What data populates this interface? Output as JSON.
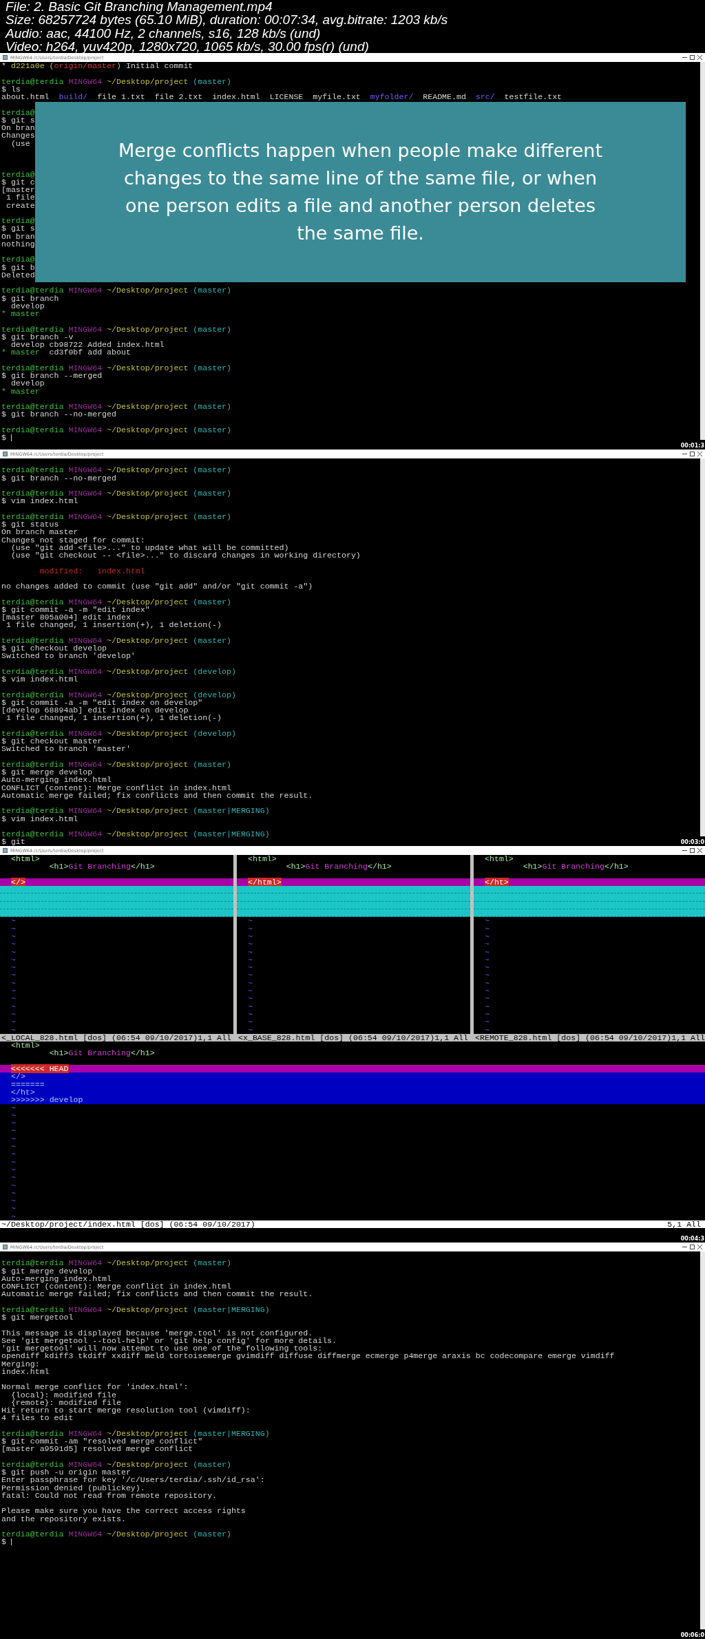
{
  "header": {
    "lines": [
      "File: 2. Basic Git Branching Management.mp4",
      "Size: 68257724 bytes (65.10 MiB), duration: 00:07:34, avg.bitrate: 1203 kb/s",
      "Audio: aac, 44100 Hz, 2 channels, s16, 128 kb/s (und)",
      "Video: h264, yuv420p, 1280x720, 1065 kb/s, 30.00 fps(r) (und)"
    ]
  },
  "frames": [
    {
      "kind": "terminal",
      "title": "MINGW64:/c/Users/terdia/Desktop/project",
      "timestamp": "00:01:3",
      "overlay": {
        "text": "Merge conflicts happen when people make different changes to the same line of the same file, or when one person edits a file and another person deletes the same file."
      },
      "lines": [
        {
          "kind": "segments",
          "segments": [
            {
              "kind": "plain",
              "text": "* "
            },
            {
              "kind": "hash",
              "text": "d221a0e ("
            },
            {
              "kind": "ref",
              "text": "origin/master"
            },
            {
              "kind": "hash",
              "text": ")"
            },
            {
              "kind": "plain",
              "text": " Initial commit"
            }
          ]
        },
        {
          "kind": "blank"
        },
        {
          "kind": "prompt",
          "user": "terdia@terdia",
          "system": "MINGW64",
          "path": "~/Desktop/project",
          "branch": "(master)"
        },
        {
          "kind": "text",
          "text": "$ ls"
        },
        {
          "kind": "segments",
          "segments": [
            {
              "kind": "plain",
              "text": "about.html  "
            },
            {
              "kind": "dir",
              "text": "build/"
            },
            {
              "kind": "plain",
              "text": "  file 1.txt  file 2.txt  index.html  LICENSE  myfile.txt  "
            },
            {
              "kind": "dir",
              "text": "myfolder/"
            },
            {
              "kind": "plain",
              "text": "  README.md  "
            },
            {
              "kind": "dir",
              "text": "src/"
            },
            {
              "kind": "plain",
              "text": "  testfile.txt"
            }
          ]
        },
        {
          "kind": "blank"
        },
        {
          "kind": "green",
          "text": "terdia@"
        },
        {
          "kind": "text",
          "text": "$ git s"
        },
        {
          "kind": "text",
          "text": "On bran"
        },
        {
          "kind": "text",
          "text": "Changes"
        },
        {
          "kind": "text",
          "text": "  (use"
        },
        {
          "kind": "blank"
        },
        {
          "kind": "blank"
        },
        {
          "kind": "blank"
        },
        {
          "kind": "green",
          "text": "terdia@"
        },
        {
          "kind": "text",
          "text": "$ git c"
        },
        {
          "kind": "text",
          "text": "[master"
        },
        {
          "kind": "text",
          "text": " 1 file"
        },
        {
          "kind": "text",
          "text": " create"
        },
        {
          "kind": "blank"
        },
        {
          "kind": "green",
          "text": "terdia@"
        },
        {
          "kind": "text",
          "text": "$ git s"
        },
        {
          "kind": "text",
          "text": "On bran"
        },
        {
          "kind": "text",
          "text": "nothing"
        },
        {
          "kind": "blank"
        },
        {
          "kind": "green",
          "text": "terdia@"
        },
        {
          "kind": "text",
          "text": "$ git b"
        },
        {
          "kind": "text",
          "text": "Deleted"
        },
        {
          "kind": "blank"
        },
        {
          "kind": "prompt",
          "user": "terdia@terdia",
          "system": "MINGW64",
          "path": "~/Desktop/project",
          "branch": "(master)"
        },
        {
          "kind": "text",
          "text": "$ git branch"
        },
        {
          "kind": "text",
          "text": "  develop"
        },
        {
          "kind": "green",
          "text": "* master"
        },
        {
          "kind": "blank"
        },
        {
          "kind": "prompt",
          "user": "terdia@terdia",
          "system": "MINGW64",
          "path": "~/Desktop/project",
          "branch": "(master)"
        },
        {
          "kind": "text",
          "text": "$ git branch -v"
        },
        {
          "kind": "text",
          "text": "  develop cb98722 Added index.html"
        },
        {
          "kind": "segments",
          "segments": [
            {
              "kind": "current",
              "text": "* master"
            },
            {
              "kind": "plain",
              "text": "  cd3f0bf add about"
            }
          ]
        },
        {
          "kind": "blank"
        },
        {
          "kind": "prompt",
          "user": "terdia@terdia",
          "system": "MINGW64",
          "path": "~/Desktop/project",
          "branch": "(master)"
        },
        {
          "kind": "text",
          "text": "$ git branch --merged"
        },
        {
          "kind": "text",
          "text": "  develop"
        },
        {
          "kind": "green",
          "text": "* master"
        },
        {
          "kind": "blank"
        },
        {
          "kind": "prompt",
          "user": "terdia@terdia",
          "system": "MINGW64",
          "path": "~/Desktop/project",
          "branch": "(master)"
        },
        {
          "kind": "text",
          "text": "$ git branch --no-merged"
        },
        {
          "kind": "blank"
        },
        {
          "kind": "prompt",
          "user": "terdia@terdia",
          "system": "MINGW64",
          "path": "~/Desktop/project",
          "branch": "(master)"
        },
        {
          "kind": "cursor",
          "text": "$"
        }
      ]
    },
    {
      "kind": "terminal",
      "title": "MINGW64:/c/Users/terdia/Desktop/project",
      "timestamp": "00:03:0",
      "lines": [
        {
          "kind": "blank"
        },
        {
          "kind": "prompt",
          "user": "terdia@terdia",
          "system": "MINGW64",
          "path": "~/Desktop/project",
          "branch": "(master)"
        },
        {
          "kind": "text",
          "text": "$ git branch --no-merged"
        },
        {
          "kind": "blank"
        },
        {
          "kind": "prompt",
          "user": "terdia@terdia",
          "system": "MINGW64",
          "path": "~/Desktop/project",
          "branch": "(master)"
        },
        {
          "kind": "text",
          "text": "$ vim index.html"
        },
        {
          "kind": "blank"
        },
        {
          "kind": "prompt",
          "user": "terdia@terdia",
          "system": "MINGW64",
          "path": "~/Desktop/project",
          "branch": "(master)"
        },
        {
          "kind": "text",
          "text": "$ git status"
        },
        {
          "kind": "text",
          "text": "On branch master"
        },
        {
          "kind": "text",
          "text": "Changes not staged for commit:"
        },
        {
          "kind": "text",
          "text": "  (use \"git add <file>...\" to update what will be committed)"
        },
        {
          "kind": "text",
          "text": "  (use \"git checkout -- <file>...\" to discard changes in working directory)"
        },
        {
          "kind": "blank"
        },
        {
          "kind": "red",
          "text": "        modified:   index.html"
        },
        {
          "kind": "blank"
        },
        {
          "kind": "text",
          "text": "no changes added to commit (use \"git add\" and/or \"git commit -a\")"
        },
        {
          "kind": "blank"
        },
        {
          "kind": "prompt",
          "user": "terdia@terdia",
          "system": "MINGW64",
          "path": "~/Desktop/project",
          "branch": "(master)"
        },
        {
          "kind": "text",
          "text": "$ git commit -a -m \"edit index\""
        },
        {
          "kind": "text",
          "text": "[master 805a004] edit index"
        },
        {
          "kind": "text",
          "text": " 1 file changed, 1 insertion(+), 1 deletion(-)"
        },
        {
          "kind": "blank"
        },
        {
          "kind": "prompt",
          "user": "terdia@terdia",
          "system": "MINGW64",
          "path": "~/Desktop/project",
          "branch": "(master)"
        },
        {
          "kind": "text",
          "text": "$ git checkout develop"
        },
        {
          "kind": "text",
          "text": "Switched to branch 'develop'"
        },
        {
          "kind": "blank"
        },
        {
          "kind": "prompt",
          "user": "terdia@terdia",
          "system": "MINGW64",
          "path": "~/Desktop/project",
          "branch": "(develop)"
        },
        {
          "kind": "text",
          "text": "$ vim index.html"
        },
        {
          "kind": "blank"
        },
        {
          "kind": "prompt",
          "user": "terdia@terdia",
          "system": "MINGW64",
          "path": "~/Desktop/project",
          "branch": "(develop)"
        },
        {
          "kind": "text",
          "text": "$ git commit -a -m \"edit index on develop\""
        },
        {
          "kind": "text",
          "text": "[develop 68894ab] edit index on develop"
        },
        {
          "kind": "text",
          "text": " 1 file changed, 1 insertion(+), 1 deletion(-)"
        },
        {
          "kind": "blank"
        },
        {
          "kind": "prompt",
          "user": "terdia@terdia",
          "system": "MINGW64",
          "path": "~/Desktop/project",
          "branch": "(develop)"
        },
        {
          "kind": "text",
          "text": "$ git checkout master"
        },
        {
          "kind": "text",
          "text": "Switched to branch 'master'"
        },
        {
          "kind": "blank"
        },
        {
          "kind": "prompt",
          "user": "terdia@terdia",
          "system": "MINGW64",
          "path": "~/Desktop/project",
          "branch": "(master)"
        },
        {
          "kind": "text",
          "text": "$ git merge develop"
        },
        {
          "kind": "text",
          "text": "Auto-merging index.html"
        },
        {
          "kind": "text",
          "text": "CONFLICT (content): Merge conflict in index.html"
        },
        {
          "kind": "text",
          "text": "Automatic merge failed; fix conflicts and then commit the result."
        },
        {
          "kind": "blank"
        },
        {
          "kind": "prompt",
          "user": "terdia@terdia",
          "system": "MINGW64",
          "path": "~/Desktop/project",
          "branch": "(master|MERGING)"
        },
        {
          "kind": "text",
          "text": "$ vim index.html"
        },
        {
          "kind": "blank"
        },
        {
          "kind": "prompt",
          "user": "terdia@terdia",
          "system": "MINGW64",
          "path": "~/Desktop/project",
          "branch": "(master|MERGING)"
        },
        {
          "kind": "text",
          "text": "$ git"
        }
      ]
    },
    {
      "kind": "vimdiff",
      "title": "MINGW64:/c/Users/terdia/Desktop/project",
      "timestamp": "00:04:3",
      "panes": [
        {
          "lines": [
            {
              "kind": "code",
              "segments": [
                {
                  "kind": "tag",
                  "text": "<html>"
                }
              ]
            },
            {
              "kind": "code",
              "segments": [
                {
                  "kind": "tag",
                  "text": "        <h1>"
                },
                {
                  "kind": "content",
                  "text": "Git Branching"
                },
                {
                  "kind": "tag",
                  "text": "</h1>"
                }
              ]
            },
            {
              "kind": "blank"
            },
            {
              "kind": "changed",
              "text": "</>"
            },
            {
              "kind": "filler"
            },
            {
              "kind": "filler"
            },
            {
              "kind": "filler"
            },
            {
              "kind": "filler"
            }
          ],
          "empty_lines": [
            "~",
            "~",
            "~",
            "~",
            "~",
            "~",
            "~",
            "~",
            "~",
            "~",
            "~",
            "~",
            "~",
            "~",
            "~"
          ],
          "status": "<_LOCAL_828.html [dos] (06:54 09/10/2017)1,1 All"
        },
        {
          "lines": [
            {
              "kind": "code",
              "segments": [
                {
                  "kind": "tag",
                  "text": "<html>"
                }
              ]
            },
            {
              "kind": "code",
              "segments": [
                {
                  "kind": "tag",
                  "text": "        <h1>"
                },
                {
                  "kind": "content",
                  "text": "Git Branching"
                },
                {
                  "kind": "tag",
                  "text": "</h1>"
                }
              ]
            },
            {
              "kind": "blank"
            },
            {
              "kind": "changed",
              "text": "</html>"
            },
            {
              "kind": "filler"
            },
            {
              "kind": "filler"
            },
            {
              "kind": "filler"
            },
            {
              "kind": "filler"
            }
          ],
          "empty_lines": [
            "~",
            "~",
            "~",
            "~",
            "~",
            "~",
            "~",
            "~",
            "~",
            "~",
            "~",
            "~",
            "~",
            "~",
            "~"
          ],
          "status": "<x_BASE_828.html [dos] (06:54 09/10/2017)1,1 All"
        },
        {
          "lines": [
            {
              "kind": "code",
              "segments": [
                {
                  "kind": "tag",
                  "text": "<html>"
                }
              ]
            },
            {
              "kind": "code",
              "segments": [
                {
                  "kind": "tag",
                  "text": "        <h1>"
                },
                {
                  "kind": "content",
                  "text": "Git Branching"
                },
                {
                  "kind": "tag",
                  "text": "</h1>"
                }
              ]
            },
            {
              "kind": "blank"
            },
            {
              "kind": "changed",
              "text": "</ht>"
            },
            {
              "kind": "filler"
            },
            {
              "kind": "filler"
            },
            {
              "kind": "filler"
            },
            {
              "kind": "filler"
            }
          ],
          "empty_lines": [
            "~",
            "~",
            "~",
            "~",
            "~",
            "~",
            "~",
            "~",
            "~",
            "~",
            "~",
            "~",
            "~",
            "~",
            "~"
          ],
          "status": "<REMOTE_828.html [dos] (06:54 09/10/2017)1,1 All"
        }
      ],
      "merged": {
        "lines": [
          {
            "kind": "code",
            "segments": [
              {
                "kind": "tag",
                "text": "<html>"
              }
            ]
          },
          {
            "kind": "code",
            "segments": [
              {
                "kind": "tag",
                "text": "        <h1>"
              },
              {
                "kind": "content",
                "text": "Git Branching"
              },
              {
                "kind": "tag",
                "text": "</h1>"
              }
            ]
          },
          {
            "kind": "blank"
          },
          {
            "kind": "changed",
            "text": "<<<<<<< HEAD"
          },
          {
            "kind": "conflict",
            "text": "</>"
          },
          {
            "kind": "conflict",
            "text": "======="
          },
          {
            "kind": "conflict",
            "text": "</ht>"
          },
          {
            "kind": "conflict",
            "text": ">>>>>>> develop"
          }
        ],
        "empty_lines": [
          "~",
          "~",
          "~",
          "~",
          "~",
          "~",
          "~",
          "~",
          "~",
          "~",
          "~",
          "~",
          "~",
          "~",
          "~"
        ],
        "status": "~/Desktop/project/index.html [dos] (06:54 09/10/2017)",
        "position": "5,1 All"
      }
    },
    {
      "kind": "terminal",
      "title": "MINGW64:/c/Users/terdia/Desktop/project",
      "timestamp": "00:06:0",
      "lines": [
        {
          "kind": "blank"
        },
        {
          "kind": "prompt",
          "user": "terdia@terdia",
          "system": "MINGW64",
          "path": "~/Desktop/project",
          "branch": "(master)"
        },
        {
          "kind": "text",
          "text": "$ git merge develop"
        },
        {
          "kind": "text",
          "text": "Auto-merging index.html"
        },
        {
          "kind": "text",
          "text": "CONFLICT (content): Merge conflict in index.html"
        },
        {
          "kind": "text",
          "text": "Automatic merge failed; fix conflicts and then commit the result."
        },
        {
          "kind": "blank"
        },
        {
          "kind": "prompt",
          "user": "terdia@terdia",
          "system": "MINGW64",
          "path": "~/Desktop/project",
          "branch": "(master|MERGING)"
        },
        {
          "kind": "text",
          "text": "$ git mergetool"
        },
        {
          "kind": "blank"
        },
        {
          "kind": "text",
          "text": "This message is displayed because 'merge.tool' is not configured."
        },
        {
          "kind": "text",
          "text": "See 'git mergetool --tool-help' or 'git help config' for more details."
        },
        {
          "kind": "text",
          "text": "'git mergetool' will now attempt to use one of the following tools:"
        },
        {
          "kind": "text",
          "text": "opendiff kdiff3 tkdiff xxdiff meld tortoisemerge gvimdiff diffuse diffmerge ecmerge p4merge araxis bc codecompare emerge vimdiff"
        },
        {
          "kind": "text",
          "text": "Merging:"
        },
        {
          "kind": "text",
          "text": "index.html"
        },
        {
          "kind": "blank"
        },
        {
          "kind": "text",
          "text": "Normal merge conflict for 'index.html':"
        },
        {
          "kind": "text",
          "text": "  {local}: modified file"
        },
        {
          "kind": "text",
          "text": "  {remote}: modified file"
        },
        {
          "kind": "text",
          "text": "Hit return to start merge resolution tool (vimdiff):"
        },
        {
          "kind": "text",
          "text": "4 files to edit"
        },
        {
          "kind": "blank"
        },
        {
          "kind": "prompt",
          "user": "terdia@terdia",
          "system": "MINGW64",
          "path": "~/Desktop/project",
          "branch": "(master|MERGING)"
        },
        {
          "kind": "text",
          "text": "$ git commit -am \"resolved merge conflict\""
        },
        {
          "kind": "text",
          "text": "[master a9591d5] resolved merge conflict"
        },
        {
          "kind": "blank"
        },
        {
          "kind": "prompt",
          "user": "terdia@terdia",
          "system": "MINGW64",
          "path": "~/Desktop/project",
          "branch": "(master)"
        },
        {
          "kind": "text",
          "text": "$ git push -u origin master"
        },
        {
          "kind": "text",
          "text": "Enter passphrase for key '/c/Users/terdia/.ssh/id_rsa':"
        },
        {
          "kind": "text",
          "text": "Permission denied (publickey)."
        },
        {
          "kind": "text",
          "text": "fatal: Could not read from remote repository."
        },
        {
          "kind": "blank"
        },
        {
          "kind": "text",
          "text": "Please make sure you have the correct access rights"
        },
        {
          "kind": "text",
          "text": "and the repository exists."
        },
        {
          "kind": "blank"
        },
        {
          "kind": "prompt",
          "user": "terdia@terdia",
          "system": "MINGW64",
          "path": "~/Desktop/project",
          "branch": "(master)"
        },
        {
          "kind": "cursor",
          "text": "$"
        }
      ]
    }
  ]
}
